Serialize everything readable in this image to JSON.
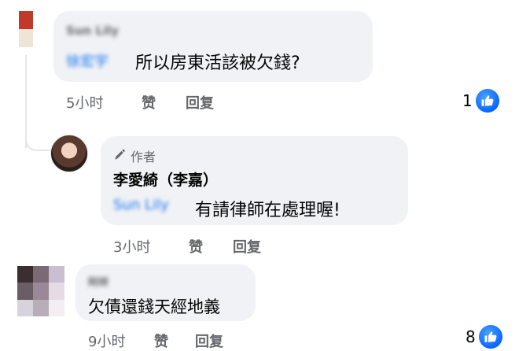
{
  "comments": [
    {
      "author_name": "Sun Lily",
      "mention": "徐宏宇",
      "text": "所以房東活該被欠錢?",
      "time": "5小时",
      "like_label": "赞",
      "reply_label": "回复",
      "reaction_count": "1"
    },
    {
      "badge_label": "作者",
      "author_name": "李愛綺（李嘉）",
      "mention": "Sun Lily",
      "text": "有請律師在處理喔!",
      "time": "3小时",
      "like_label": "赞",
      "reply_label": "回复"
    },
    {
      "author_name": "阿祥",
      "text": "欠債還錢天經地義",
      "time": "9小时",
      "like_label": "赞",
      "reply_label": "回复",
      "reaction_count": "8"
    }
  ],
  "colors": {
    "bubble": "#f0f2f5",
    "secondary_text": "#65676b",
    "like_blue": "#0866ff",
    "mention_blue": "#1877f2"
  },
  "icons": [
    "pen-icon",
    "like-icon"
  ]
}
